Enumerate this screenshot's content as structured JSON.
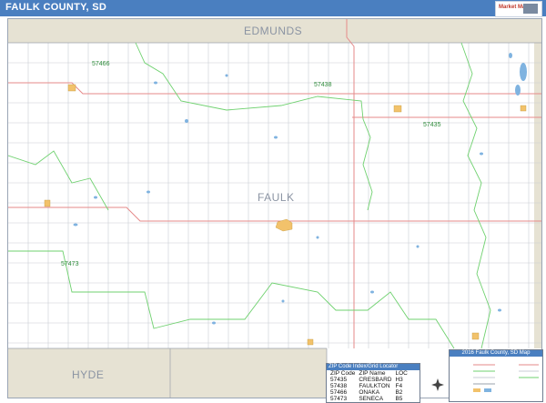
{
  "header": {
    "title": "FAULK COUNTY, SD",
    "logo_label": "Market Maps"
  },
  "map": {
    "county": "FAULK",
    "neighbors": {
      "north": "EDMUNDS",
      "south": "HYDE"
    },
    "zip_labels": [
      "57466",
      "57438",
      "57435",
      "57473"
    ],
    "colors": {
      "border_land": "#e6e2d3",
      "highway": "#e58a8a",
      "zip_boundary": "#6fd16f",
      "road": "#c9cdd4",
      "water": "#7fb3e0",
      "town": "#f2c26b",
      "title_bar": "#4a7fc0"
    }
  },
  "zip_locator": {
    "title": "ZIP Code Index/Grid Locator",
    "headers": [
      "ZIP Code",
      "ZIP Name",
      "LOC"
    ],
    "rows": [
      [
        "57435",
        "CRESBARD",
        "H3"
      ],
      [
        "57438",
        "FAULKTON",
        "F4"
      ],
      [
        "57466",
        "ONAKA",
        "B2"
      ],
      [
        "57473",
        "SENECA",
        "B5"
      ]
    ]
  },
  "legend": {
    "title": "2016 Faulk County, SD Map"
  }
}
